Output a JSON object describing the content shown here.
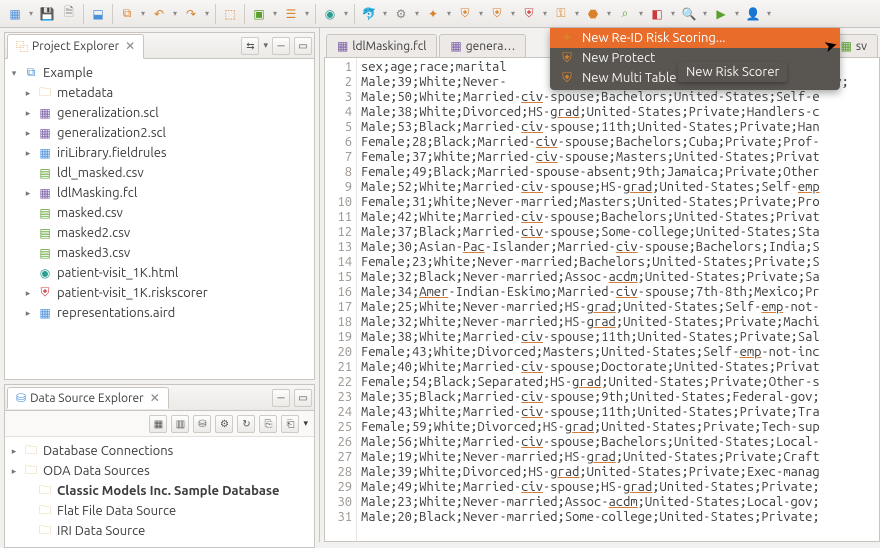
{
  "toolbar_icons": [
    {
      "name": "new-icon",
      "glyph": "▦",
      "cls": "ci-blue",
      "dd": true
    },
    {
      "name": "save-icon",
      "glyph": "💾",
      "cls": "ci-gray",
      "dd": false
    },
    {
      "name": "save-all-icon",
      "glyph": "🗎",
      "cls": "ci-gray",
      "dd": false
    },
    {
      "name": "sep"
    },
    {
      "name": "binary-icon",
      "glyph": "⬓",
      "cls": "ci-blue",
      "dd": false
    },
    {
      "name": "sep"
    },
    {
      "name": "outline-icon",
      "glyph": "⧉",
      "cls": "ci-orange",
      "dd": true
    },
    {
      "name": "undo-icon",
      "glyph": "↶",
      "cls": "ci-orange",
      "dd": true
    },
    {
      "name": "redo-icon",
      "glyph": "↷",
      "cls": "ci-orange",
      "dd": true
    },
    {
      "name": "sep"
    },
    {
      "name": "open-type-icon",
      "glyph": "⬚",
      "cls": "ci-orange",
      "dd": false
    },
    {
      "name": "sep"
    },
    {
      "name": "run-icon",
      "glyph": "▣",
      "cls": "ci-green",
      "dd": true
    },
    {
      "name": "debug-tool-icon",
      "glyph": "☰",
      "cls": "ci-orange",
      "dd": true
    },
    {
      "name": "sep"
    },
    {
      "name": "globe-icon",
      "glyph": "◉",
      "cls": "ci-teal",
      "dd": true
    },
    {
      "name": "sep"
    },
    {
      "name": "dolphin-icon",
      "glyph": "🐬",
      "cls": "ci-gray",
      "dd": true
    },
    {
      "name": "gear-icon",
      "glyph": "⚙",
      "cls": "ci-gray",
      "dd": true
    },
    {
      "name": "wizard-icon",
      "glyph": "✦",
      "cls": "ci-orange",
      "dd": true
    },
    {
      "name": "shield1-icon",
      "glyph": "⛨",
      "cls": "ci-orange",
      "dd": true
    },
    {
      "name": "shield2-icon",
      "glyph": "⛨",
      "cls": "ci-orange",
      "dd": true
    },
    {
      "name": "shield3-icon",
      "glyph": "⛨",
      "cls": "ci-red",
      "dd": true
    },
    {
      "name": "key-icon",
      "glyph": "⚿",
      "cls": "ci-orange",
      "dd": true
    },
    {
      "name": "cylinder-icon",
      "glyph": "⬣",
      "cls": "ci-orange",
      "dd": true
    },
    {
      "name": "scope-icon",
      "glyph": "⌕",
      "cls": "ci-green",
      "dd": true
    },
    {
      "name": "red-icon",
      "glyph": "◧",
      "cls": "ci-red",
      "dd": true
    },
    {
      "name": "search-icon",
      "glyph": "🔍",
      "cls": "ci-gray",
      "dd": true
    },
    {
      "name": "play-icon",
      "glyph": "▶",
      "cls": "ci-green",
      "dd": true
    },
    {
      "name": "person-icon",
      "glyph": "👤",
      "cls": "ci-red",
      "dd": true
    }
  ],
  "project_explorer": {
    "title": "Project Explorer",
    "root": "Example",
    "nodes": [
      {
        "label": "metadata",
        "icon": "folder",
        "cls": "ci-folder",
        "exp": true
      },
      {
        "label": "generalization.scl",
        "icon": "file-scl",
        "cls": "ci-purple",
        "exp": true
      },
      {
        "label": "generalization2.scl",
        "icon": "file-scl",
        "cls": "ci-purple",
        "exp": true
      },
      {
        "label": "iriLibrary.fieldrules",
        "icon": "file-rules",
        "cls": "ci-blue",
        "exp": true
      },
      {
        "label": "ldl_masked.csv",
        "icon": "file-csv",
        "cls": "ci-green",
        "exp": false
      },
      {
        "label": "ldlMasking.fcl",
        "icon": "file-fcl",
        "cls": "ci-purple",
        "exp": true
      },
      {
        "label": "masked.csv",
        "icon": "file-csv",
        "cls": "ci-green",
        "exp": false
      },
      {
        "label": "masked2.csv",
        "icon": "file-csv",
        "cls": "ci-green",
        "exp": false
      },
      {
        "label": "masked3.csv",
        "icon": "file-csv",
        "cls": "ci-green",
        "exp": false
      },
      {
        "label": "patient-visit_1K.html",
        "icon": "file-html",
        "cls": "ci-teal",
        "exp": false
      },
      {
        "label": "patient-visit_1K.riskscorer",
        "icon": "file-risk",
        "cls": "ci-red",
        "exp": true
      },
      {
        "label": "representations.aird",
        "icon": "file-aird",
        "cls": "ci-blue",
        "exp": true
      }
    ]
  },
  "data_source_explorer": {
    "title": "Data Source Explorer",
    "nodes": [
      {
        "label": "Database Connections",
        "icon": "folder",
        "cls": "ci-folder",
        "ind": 0,
        "exp": true,
        "bold": false
      },
      {
        "label": "ODA Data Sources",
        "icon": "folder",
        "cls": "ci-folder",
        "ind": 0,
        "exp": true,
        "bold": false
      },
      {
        "label": "Classic Models Inc. Sample Database",
        "icon": "folder",
        "cls": "ci-folder",
        "ind": 1,
        "exp": false,
        "bold": true
      },
      {
        "label": "Flat File Data Source",
        "icon": "folder",
        "cls": "ci-folder",
        "ind": 1,
        "exp": false,
        "bold": false
      },
      {
        "label": "IRI Data Source",
        "icon": "folder",
        "cls": "ci-folder",
        "ind": 1,
        "exp": false,
        "bold": false
      }
    ]
  },
  "editor": {
    "tabs": [
      {
        "label": "ldlMasking.fcl",
        "icon": "ci-purple",
        "active": false
      },
      {
        "label": "genera…",
        "icon": "ci-purple",
        "active": false
      },
      {
        "label": "sv",
        "icon": "ci-green",
        "active": false,
        "partial": true
      }
    ],
    "lines": [
      "sex;age;race;marital",
      "Male;39;White;Never-                                           gov;",
      "Male;50;White;Married-civ-spouse;Bachelors;United-States;Self-e",
      "Male;38;White;Divorced;HS-grad;United-States;Private;Handlers-c",
      "Male;53;Black;Married-civ-spouse;11th;United-States;Private;Han",
      "Female;28;Black;Married-civ-spouse;Bachelors;Cuba;Private;Prof-",
      "Female;37;White;Married-civ-spouse;Masters;United-States;Privat",
      "Female;49;Black;Married-spouse-absent;9th;Jamaica;Private;Other",
      "Male;52;White;Married-civ-spouse;HS-grad;United-States;Self-emp",
      "Female;31;White;Never-married;Masters;United-States;Private;Pro",
      "Male;42;White;Married-civ-spouse;Bachelors;United-States;Privat",
      "Male;37;Black;Married-civ-spouse;Some-college;United-States;Sta",
      "Male;30;Asian-Pac-Islander;Married-civ-spouse;Bachelors;India;S",
      "Female;23;White;Never-married;Bachelors;United-States;Private;S",
      "Male;32;Black;Never-married;Assoc-acdm;United-States;Private;Sa",
      "Male;34;Amer-Indian-Eskimo;Married-civ-spouse;7th-8th;Mexico;Pr",
      "Male;25;White;Never-married;HS-grad;United-States;Self-emp-not-",
      "Male;32;White;Never-married;HS-grad;United-States;Private;Machi",
      "Male;38;White;Married-civ-spouse;11th;United-States;Private;Sal",
      "Female;43;White;Divorced;Masters;United-States;Self-emp-not-inc",
      "Male;40;White;Married-civ-spouse;Doctorate;United-States;Privat",
      "Female;54;Black;Separated;HS-grad;United-States;Private;Other-s",
      "Male;35;Black;Married-civ-spouse;9th;United-States;Federal-gov;",
      "Male;43;White;Married-civ-spouse;11th;United-States;Private;Tra",
      "Female;59;White;Divorced;HS-grad;United-States;Private;Tech-sup",
      "Male;56;White;Married-civ-spouse;Bachelors;United-States;Local-",
      "Male;19;White;Never-married;HS-grad;United-States;Private;Craft",
      "Male;39;White;Divorced;HS-grad;United-States;Private;Exec-manag",
      "Male;49;White;Married-civ-spouse;HS-grad;United-States;Private;",
      "Male;23;White;Never-married;Assoc-acdm;United-States;Local-gov;",
      "Male;20;Black;Never-married;Some-college;United-States;Private;"
    ]
  },
  "dropdown": {
    "items": [
      {
        "label": "New Re-ID Risk Scoring...",
        "hl": true,
        "icon": "✦"
      },
      {
        "label": "New Protect",
        "hl": false,
        "icon": "⛨"
      },
      {
        "label": "New Multi Table Protection Job...",
        "hl": false,
        "icon": "⛨"
      }
    ]
  },
  "tooltip": "New Risk Scorer"
}
